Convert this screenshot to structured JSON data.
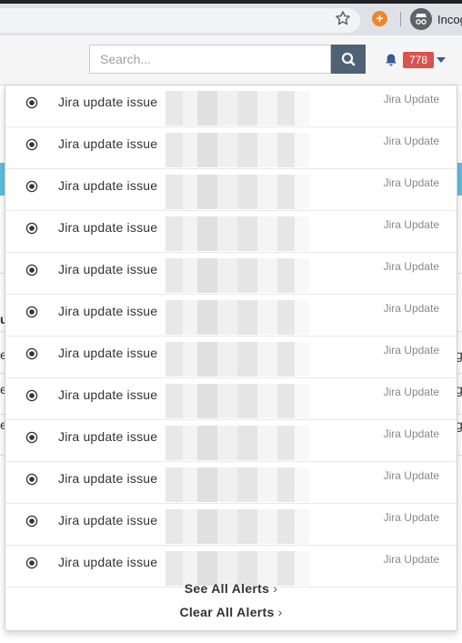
{
  "browser": {
    "profile_label": "Incog",
    "extension_glyph": "+"
  },
  "header": {
    "search_placeholder": "Search...",
    "notification_count": "778"
  },
  "background_fragments": [
    "u",
    "e",
    "e",
    "e",
    "g",
    "g",
    "g"
  ],
  "alerts": [
    {
      "text": "Jira update issue",
      "source": "Jira Update"
    },
    {
      "text": "Jira update issue",
      "source": "Jira Update"
    },
    {
      "text": "Jira update issue",
      "source": "Jira Update"
    },
    {
      "text": "Jira update issue",
      "source": "Jira Update"
    },
    {
      "text": "Jira update issue",
      "source": "Jira Update"
    },
    {
      "text": "Jira update issue",
      "source": "Jira Update"
    },
    {
      "text": "Jira update issue",
      "source": "Jira Update"
    },
    {
      "text": "Jira update issue",
      "source": "Jira Update"
    },
    {
      "text": "Jira update issue",
      "source": "Jira Update"
    },
    {
      "text": "Jira update issue",
      "source": "Jira Update"
    },
    {
      "text": "Jira update issue",
      "source": "Jira Update"
    },
    {
      "text": "Jira update issue",
      "source": "Jira Update"
    }
  ],
  "footer": {
    "see_all": "See All Alerts",
    "clear_all": "Clear All Alerts",
    "chevron": "›"
  },
  "icons": {
    "star": "star-icon",
    "search": "search-icon",
    "bell": "bell-icon",
    "alert": "radio-target-icon",
    "incognito": "incognito-icon"
  },
  "colors": {
    "badge": "#d9534f",
    "search_button": "#4f6175",
    "bell": "#3b5a91",
    "background_banner": "#5bc0de"
  }
}
